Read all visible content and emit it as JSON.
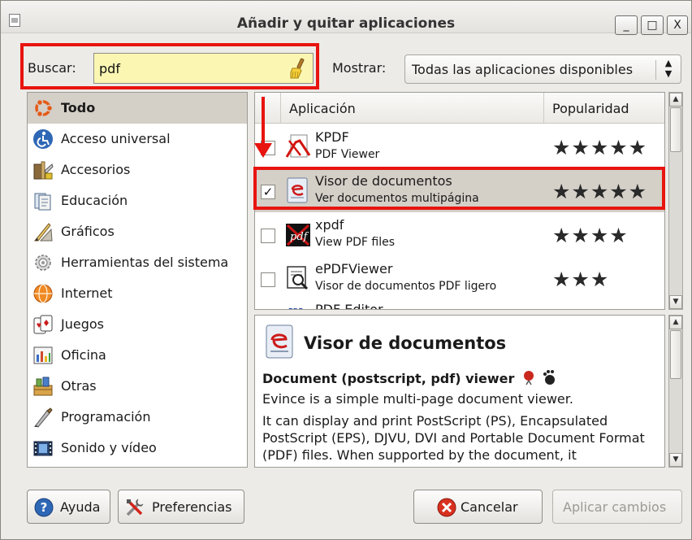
{
  "window": {
    "title": "Añadir y quitar aplicaciones",
    "minimize": "_",
    "maximize": "□",
    "close": "X"
  },
  "search": {
    "label": "Buscar:",
    "value": "pdf"
  },
  "filter": {
    "label": "Mostrar:",
    "selected": "Todas las aplicaciones disponibles"
  },
  "categories": [
    {
      "label": "Todo",
      "icon": "ubuntu-logo-icon",
      "selected": true
    },
    {
      "label": "Acceso universal",
      "icon": "accessibility-icon"
    },
    {
      "label": "Accesorios",
      "icon": "accessories-icon"
    },
    {
      "label": "Educación",
      "icon": "education-icon"
    },
    {
      "label": "Gráficos",
      "icon": "graphics-icon"
    },
    {
      "label": "Herramientas del sistema",
      "icon": "system-tools-icon"
    },
    {
      "label": "Internet",
      "icon": "internet-icon"
    },
    {
      "label": "Juegos",
      "icon": "games-icon"
    },
    {
      "label": "Oficina",
      "icon": "office-icon"
    },
    {
      "label": "Otras",
      "icon": "other-icon"
    },
    {
      "label": "Programación",
      "icon": "programming-icon"
    },
    {
      "label": "Sonido y vídeo",
      "icon": "sound-video-icon"
    }
  ],
  "apps_table": {
    "col_app": "Aplicación",
    "col_popularity": "Popularidad",
    "rows": [
      {
        "name": "KPDF",
        "desc": "PDF Viewer",
        "checked": false,
        "stars": "★★★★★",
        "rating": 5,
        "icon": "kpdf-icon"
      },
      {
        "name": "Visor de documentos",
        "desc": "Ver documentos multipágina",
        "checked": true,
        "stars": "★★★★★",
        "rating": 5,
        "icon": "evince-icon"
      },
      {
        "name": "xpdf",
        "desc": "View PDF files",
        "checked": false,
        "stars": "★★★★",
        "rating": 4,
        "icon": "xpdf-icon"
      },
      {
        "name": "ePDFViewer",
        "desc": "Visor de documentos PDF ligero",
        "checked": false,
        "stars": "★★★",
        "rating": 3,
        "icon": "epdfviewer-icon"
      },
      {
        "name": "PDF Editor",
        "desc": "",
        "checked": false,
        "stars": "",
        "icon": "pdf-editor-icon"
      }
    ]
  },
  "description": {
    "title": "Visor de documentos",
    "subtitle": "Document (postscript, pdf) viewer",
    "line1": "Evince is a simple multi-page document viewer.",
    "line2": "It can display and print PostScript (PS), Encapsulated PostScript (EPS), DJVU, DVI and Portable Document Format (PDF) files. When supported by the document, it"
  },
  "buttons": {
    "help": "Ayuda",
    "preferences": "Preferencias",
    "cancel": "Cancelar",
    "apply": "Aplicar cambios"
  },
  "colors": {
    "highlight": "#e8140f",
    "selection": "#d4cfc7",
    "search_bg": "#fbf7b3"
  }
}
